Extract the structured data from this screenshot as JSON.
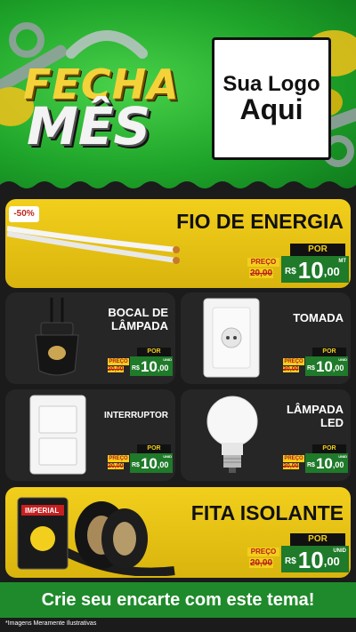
{
  "header": {
    "title_line1": "FECHA",
    "title_line2": "MÊS",
    "logo_line1": "Sua Logo",
    "logo_line2": "Aqui"
  },
  "colors": {
    "green": "#1fa52a",
    "yellow": "#f2cf1c",
    "dark": "#1b1b1b",
    "price_green": "#1f7a2a"
  },
  "price_labels": {
    "por": "POR",
    "preco": "PREÇO",
    "currency": "R$"
  },
  "fio": {
    "badge": "-50%",
    "name": "FIO DE ENERGIA",
    "old_price": "20,00",
    "price_int": "10",
    "price_dec": ",00",
    "unit": "MT"
  },
  "bocal": {
    "name_line1": "BOCAL DE",
    "name_line2": "LÂMPADA",
    "old_price": "20,00",
    "price_int": "10",
    "price_dec": ",00",
    "unit": "UNID"
  },
  "tomada": {
    "name": "TOMADA",
    "old_price": "20,00",
    "price_int": "10",
    "price_dec": ",00",
    "unit": "UNID"
  },
  "interruptor": {
    "name": "INTERRUPTOR",
    "old_price": "20,00",
    "price_int": "10",
    "price_dec": ",00",
    "unit": "UNID"
  },
  "lampada": {
    "name_line1": "LÂMPADA",
    "name_line2": "LED",
    "old_price": "20,00",
    "price_int": "10",
    "price_dec": ",00",
    "unit": "UNID"
  },
  "fita": {
    "name": "FITA ISOLANTE",
    "brand": "IMPERIAL",
    "old_price": "20,00",
    "price_int": "10",
    "price_dec": ",00",
    "unit": "UNID"
  },
  "footer": {
    "cta": "Crie seu encarte com este tema!",
    "disclaimer": "*Imagens Meramente Ilustrativas"
  }
}
